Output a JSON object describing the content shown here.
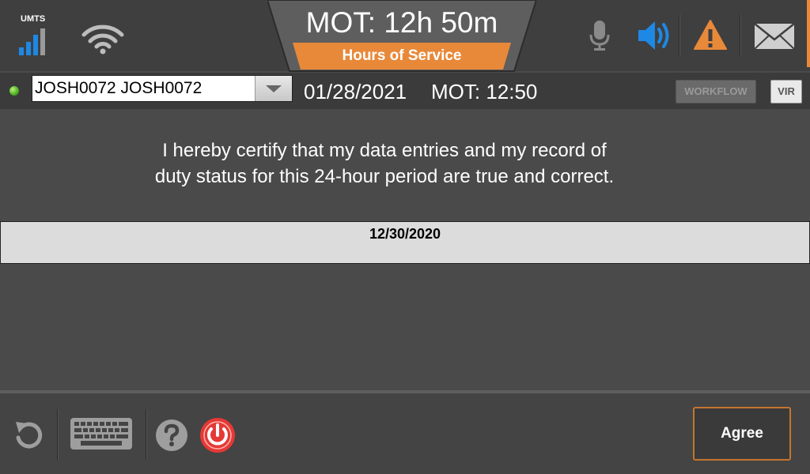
{
  "header": {
    "network_type": "UMTS",
    "mot_title": "MOT: 12h 50m",
    "hos_label": "Hours of Service"
  },
  "row2": {
    "driver_selected": "JOSH0072 JOSH0072",
    "date": "01/28/2021",
    "mot": "MOT: 12:50",
    "workflow_label": "WORKFLOW",
    "vir_label": "VIR"
  },
  "content": {
    "cert_line1": "I hereby certify that my data entries and my record of",
    "cert_line2": "duty status for this 24-hour period are true and correct.",
    "date_row": "12/30/2020"
  },
  "footer": {
    "agree_label": "Agree"
  },
  "colors": {
    "accent_orange": "#e8893a",
    "speaker_blue": "#1e88e5",
    "power_red": "#e53935"
  },
  "icons": [
    "signal-icon",
    "wifi-icon",
    "microphone-icon",
    "speaker-icon",
    "warning-icon",
    "mail-icon",
    "refresh-icon",
    "keyboard-icon",
    "help-icon",
    "power-icon"
  ]
}
